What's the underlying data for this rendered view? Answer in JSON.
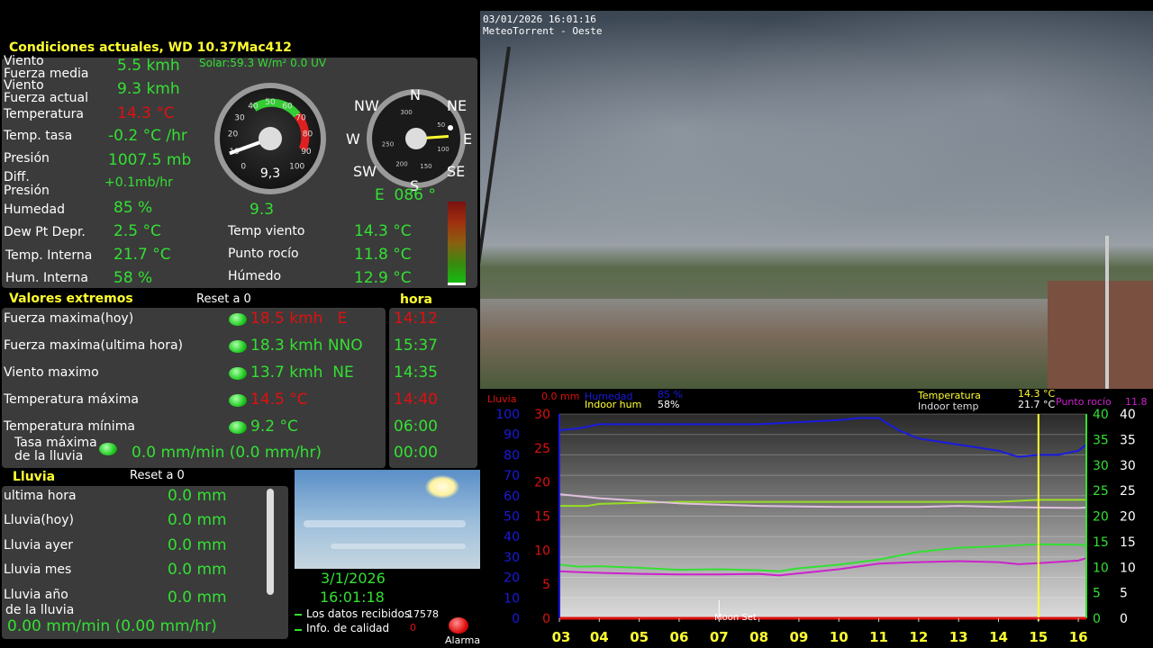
{
  "title": "Condiciones actuales, WD 10.37Mac412",
  "solar": "Solar:59.3 W/m² 0.0 UV",
  "current": {
    "viento_label": "Viento",
    "viento_value": "5.5 kmh",
    "fuerza_media_label": "Fuerza media",
    "viento2_label": "Viento",
    "fuerza_actual_value": "9.3 kmh",
    "fuerza_actual_label": "Fuerza actual",
    "temperatura_label": "Temperatura",
    "temperatura_value": "14.3 °C",
    "temp_tasa_label": "Temp. tasa",
    "temp_tasa_value": "-0.2 °C /hr",
    "presion_label": "Presión",
    "presion_value": "1007.5 mb",
    "diff_label": "Diff.",
    "presion2_label": "Presión",
    "diff_value": "+0.1mb/hr",
    "humedad_label": "Humedad",
    "humedad_value": "85 %",
    "gust_mid": "9.3",
    "dew_label": "Dew Pt Depr.",
    "dew_value": "2.5 °C",
    "temp_viento_label": "Temp viento",
    "temp_viento_value": "14.3 °C",
    "temp_interna_label": "Temp. Interna",
    "temp_interna_value": "21.7 °C",
    "punto_rocio_label": "Punto rocío",
    "punto_rocio_value": "11.8 °C",
    "hum_interna_label": "Hum. Interna",
    "hum_interna_value": "58 %",
    "humedo_label": "Húmedo",
    "humedo_value": "12.9 °C"
  },
  "gauge": {
    "ticks": [
      "0",
      "10",
      "20",
      "30",
      "40",
      "50",
      "60",
      "70",
      "80",
      "90",
      "100"
    ],
    "readout": "9,3",
    "value": 9.3
  },
  "compass": {
    "n": "N",
    "ne": "NE",
    "e": "E",
    "se": "SE",
    "s": "S",
    "sw": "SW",
    "w": "W",
    "nw": "NW",
    "inner_ticks": [
      "300",
      "50",
      "100",
      "150",
      "200",
      "250"
    ],
    "readout": "E  086 °",
    "bearing": 86
  },
  "extremos": {
    "title": "Valores extremos",
    "reset": "Reset a 0",
    "hora_title": "hora",
    "rows": [
      {
        "label": "Fuerza maxima(hoy)",
        "value": "18.5 kmh   E",
        "time": "14:12",
        "red": true
      },
      {
        "label": "Fuerza maxima(ultima hora)",
        "value": "18.3 kmh NNO",
        "time": "15:37",
        "red": false
      },
      {
        "label": "Viento maximo",
        "value": "13.7 kmh  NE",
        "time": "14:35",
        "red": false
      },
      {
        "label": "Temperatura máxima",
        "value": "14.5 °C",
        "time": "14:40",
        "red": true
      },
      {
        "label": "Temperatura mínima",
        "value": "9.2 °C",
        "time": "06:00",
        "red": false
      }
    ],
    "tasa_label1": "Tasa máxima",
    "tasa_label2": "de la lluvia",
    "tasa_value": "0.0 mm/min (0.0 mm/hr)",
    "tasa_time": "00:00"
  },
  "lluvia": {
    "title": "Lluvia",
    "reset": "Reset a 0",
    "rows": [
      {
        "label": "ultima hora",
        "value": "0.0 mm"
      },
      {
        "label": "Lluvia(hoy)",
        "value": "0.0 mm"
      },
      {
        "label": "Lluvia ayer",
        "value": "0.0 mm"
      },
      {
        "label": "Lluvia mes",
        "value": "0.0 mm"
      }
    ],
    "anio_label1": "Lluvia año",
    "anio_label2": "de la lluvia",
    "anio_value": "0.0 mm",
    "rate": "0.00 mm/min (0.00 mm/hr)"
  },
  "status": {
    "date": "3/1/2026",
    "time": "16:01:18",
    "datos_label": "Los datos recibidos",
    "datos_value": "17578",
    "calidad_label": "Info. de calidad",
    "calidad_value": "0",
    "alarma": "Alarma"
  },
  "camera": {
    "timestamp": "03/01/2026 16:01:16",
    "caption": "MeteoTorrent - Oeste"
  },
  "chart_data": {
    "type": "line",
    "legend": {
      "lluvia": "Lluvia",
      "lluvia_val": "0.0 mm",
      "humedad": "Humedad",
      "humedad_val": "85 %",
      "indoor_hum": "Indoor hum",
      "indoor_hum_val": "58%",
      "temperatura": "Temperatura",
      "temperatura_val": "14.3 °C",
      "indoor_temp": "Indoor temp",
      "indoor_temp_val": "21.7 °C",
      "punto_rocio": "Punto rocío",
      "punto_rocio_val": "11.8"
    },
    "x_ticks": [
      "03",
      "04",
      "05",
      "06",
      "07",
      "08",
      "09",
      "10",
      "11",
      "12",
      "13",
      "14",
      "15",
      "16"
    ],
    "xlim": [
      3,
      16.2
    ],
    "axis_humidity": {
      "ticks": [
        "0",
        "10",
        "20",
        "30",
        "40",
        "50",
        "60",
        "70",
        "80",
        "90",
        "100"
      ],
      "ylim": [
        0,
        100
      ]
    },
    "axis_left2": {
      "ticks": [
        "0",
        "5",
        "10",
        "15",
        "20",
        "25",
        "30"
      ],
      "ylim": [
        0,
        30
      ]
    },
    "axis_right1": {
      "ticks": [
        "0",
        "5",
        "10",
        "15",
        "20",
        "25",
        "30",
        "35",
        "40"
      ],
      "ylim": [
        0,
        40
      ]
    },
    "axis_right2": {
      "ticks": [
        "0",
        "5",
        "10",
        "15",
        "20",
        "25",
        "30",
        "35",
        "40"
      ],
      "ylim": [
        0,
        40
      ]
    },
    "annotation": "Moon Set",
    "marker_x": 15,
    "series": [
      {
        "name": "Humedad",
        "axis": "humidity",
        "color": "#1a1ae0",
        "x": [
          3,
          3.5,
          4,
          6,
          8,
          10,
          10.5,
          11,
          11.5,
          12,
          13,
          14,
          14.5,
          15,
          15.5,
          16,
          16.2
        ],
        "y": [
          92,
          93,
          95,
          95,
          95,
          97,
          98,
          98,
          92,
          88,
          85,
          82,
          79,
          80,
          80,
          82,
          85
        ]
      },
      {
        "name": "Indoor hum",
        "axis": "humidity",
        "color": "#99dd22",
        "x": [
          3,
          3.7,
          4,
          6,
          8,
          10,
          12,
          13,
          14,
          15,
          16,
          16.2
        ],
        "y": [
          55,
          55,
          56,
          57,
          57,
          57,
          57,
          57,
          57,
          58,
          58,
          58
        ]
      },
      {
        "name": "Indoor temp",
        "axis": "right1",
        "color": "#e0c0e0",
        "x": [
          3,
          4,
          6,
          8,
          10,
          12,
          13,
          14,
          15,
          16,
          16.2
        ],
        "y": [
          24.3,
          23.5,
          22.5,
          22,
          21.8,
          21.8,
          22,
          21.8,
          21.7,
          21.6,
          21.7
        ]
      },
      {
        "name": "Temperatura",
        "axis": "right1",
        "color": "#33e033",
        "x": [
          3,
          3.5,
          4,
          5,
          6,
          7,
          8,
          8.5,
          9,
          10,
          11,
          12,
          13,
          14,
          15,
          16,
          16.2
        ],
        "y": [
          10.5,
          10.1,
          10.2,
          9.9,
          9.5,
          9.6,
          9.4,
          9.2,
          9.8,
          10.5,
          11.5,
          13,
          13.8,
          14.1,
          14.5,
          14.4,
          14.3
        ]
      },
      {
        "name": "Punto rocío",
        "axis": "right1",
        "color": "#cc22cc",
        "x": [
          3,
          4,
          5,
          6,
          7,
          8,
          8.5,
          9,
          10,
          11,
          12,
          13,
          14,
          14.5,
          15,
          16,
          16.2
        ],
        "y": [
          9.2,
          8.9,
          8.7,
          8.6,
          8.6,
          8.7,
          8.4,
          8.8,
          9.6,
          10.7,
          11,
          11.2,
          11.0,
          10.6,
          10.8,
          11.3,
          11.8
        ]
      },
      {
        "name": "Lluvia",
        "axis": "left2",
        "color": "#e01010",
        "x": [
          3,
          16.2
        ],
        "y": [
          0,
          0
        ]
      }
    ]
  }
}
